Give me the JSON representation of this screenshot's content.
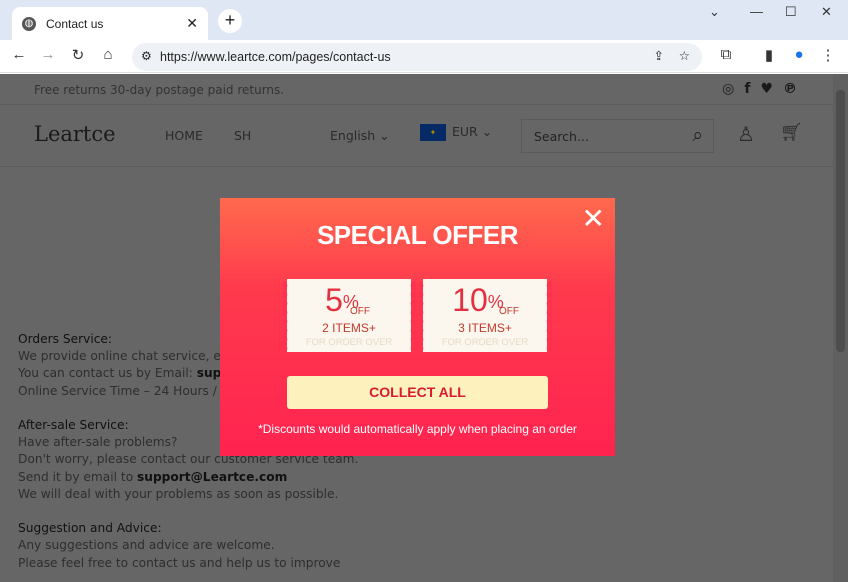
{
  "browser": {
    "tab_title": "Contact us",
    "url": "https://www.leartce.com/pages/contact-us"
  },
  "page": {
    "announcement": "Free returns 30-day postage paid returns.",
    "logo": "Leartce",
    "nav": [
      "HOME",
      "SH"
    ],
    "language": "English",
    "currency": "EUR",
    "search_placeholder": "Search...",
    "content": {
      "orders_title": "Orders Service:",
      "orders_lines": [
        "We provide online chat service, em",
        "You can contact us by Email: ",
        "Online Service Time – 24 Hours / 7"
      ],
      "orders_email": "supp",
      "aftersale_title": "After-sale Service:",
      "aftersale_lines": [
        "Have after-sale problems?",
        "Don't worry, please contact our customer service team.",
        "Send it by email to ",
        "We will deal with your problems as soon as possible."
      ],
      "aftersale_email": "support@Leartce.com",
      "suggestion_title": "Suggestion and Advice:",
      "suggestion_lines": [
        "Any suggestions and advice are welcome.",
        "Please feel free to contact us and help us to improve"
      ]
    }
  },
  "popup": {
    "title": "SPECIAL OFFER",
    "coupons": [
      {
        "value": "5",
        "percent": "%",
        "off": "OFF",
        "items": "2 ITEMS+",
        "min": "FOR ORDER OVER"
      },
      {
        "value": "10",
        "percent": "%",
        "off": "OFF",
        "items": "3 ITEMS+",
        "min": "FOR ORDER OVER"
      }
    ],
    "button": "COLLECT ALL",
    "note": "*Discounts would automatically apply when placing an order"
  },
  "colors": {
    "popup_top": "#ff6a4d",
    "popup_bottom": "#ff2350",
    "button_bg": "#fdf1bd",
    "button_text": "#d81b30"
  }
}
